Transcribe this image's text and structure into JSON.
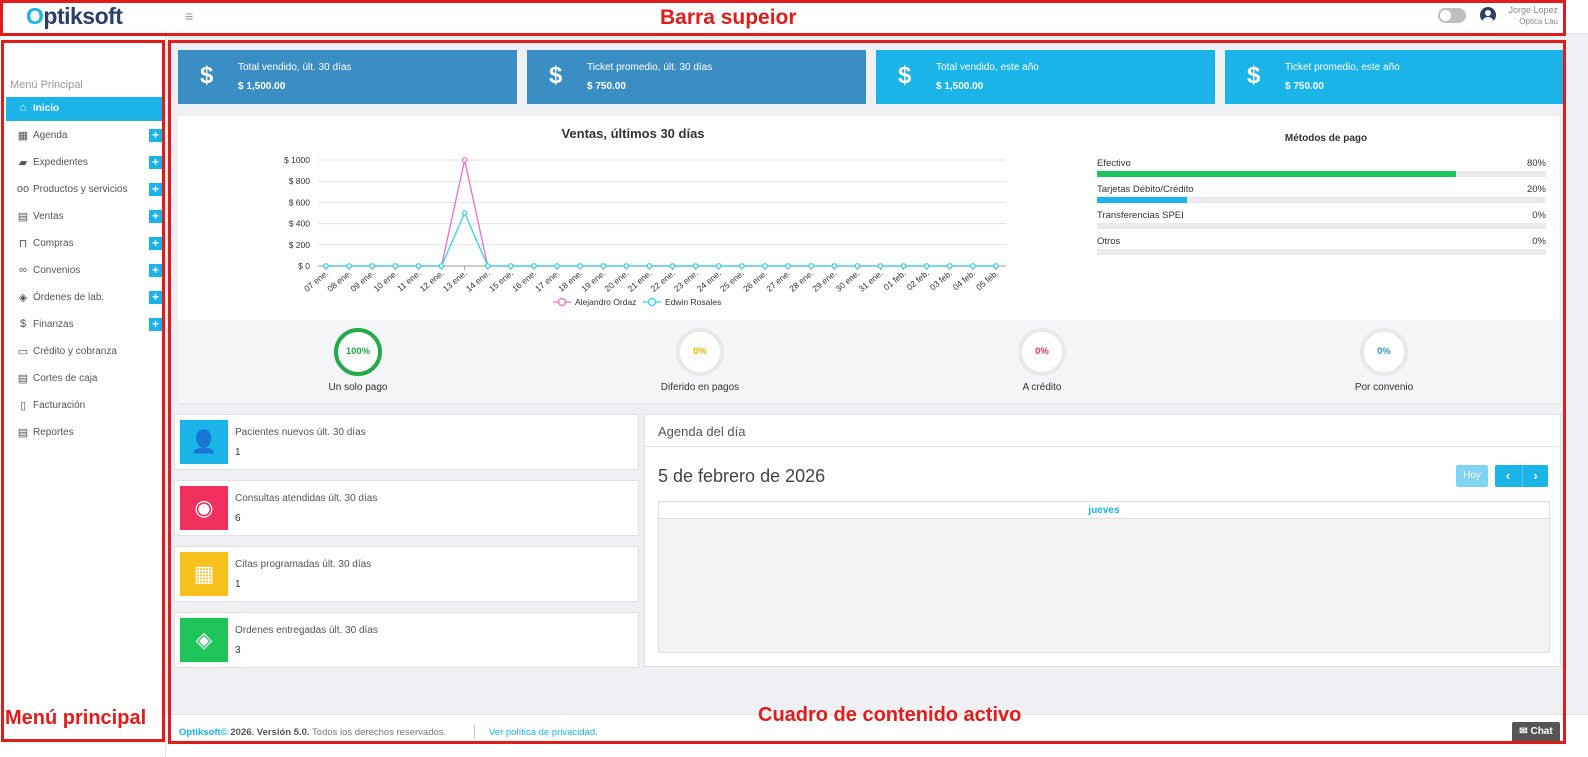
{
  "annotations": {
    "top": "Barra supeior",
    "menu": "Menú principal",
    "content": "Cuadro de contenido activo"
  },
  "topbar": {
    "logo_o": "O",
    "logo_rest": "ptiksoft",
    "hamburger_icon": "menu-icon",
    "user_name": "Jorge Lopez",
    "user_org": "Optica Lau"
  },
  "sidebar": {
    "title": "Menú Principal",
    "items": [
      {
        "label": "Inicio",
        "icon": "home-icon",
        "glyph": "⌂",
        "plus": false,
        "active": true
      },
      {
        "label": "Agenda",
        "icon": "calendar-icon",
        "glyph": "▦",
        "plus": true
      },
      {
        "label": "Expedientes",
        "icon": "folder-icon",
        "glyph": "▰",
        "plus": true
      },
      {
        "label": "Productos y servicios",
        "icon": "glasses-icon",
        "glyph": "oo",
        "plus": true
      },
      {
        "label": "Ventas",
        "icon": "cash-register-icon",
        "glyph": "▤",
        "plus": true
      },
      {
        "label": "Compras",
        "icon": "basket-icon",
        "glyph": "⊓",
        "plus": true
      },
      {
        "label": "Convenios",
        "icon": "handshake-icon",
        "glyph": "∞",
        "plus": true
      },
      {
        "label": "Órdenes de lab.",
        "icon": "tags-icon",
        "glyph": "◈",
        "plus": true
      },
      {
        "label": "Finanzas",
        "icon": "hand-money-icon",
        "glyph": "$",
        "plus": true
      },
      {
        "label": "Crédito y cobranza",
        "icon": "money-bill-icon",
        "glyph": "▭",
        "plus": false
      },
      {
        "label": "Cortes de caja",
        "icon": "register-icon",
        "glyph": "▤",
        "plus": false
      },
      {
        "label": "Facturación",
        "icon": "invoice-icon",
        "glyph": "▯",
        "plus": false
      },
      {
        "label": "Reportes",
        "icon": "file-icon",
        "glyph": "▤",
        "plus": false
      }
    ]
  },
  "stats": [
    {
      "label": "Total vendido, últ. 30 días",
      "value": "$ 1,500.00",
      "color": "#3a8ec4",
      "icon": "dollar-icon"
    },
    {
      "label": "Ticket promedio, últ. 30 días",
      "value": "$ 750.00",
      "color": "#3a8ec4",
      "icon": "dollar-icon"
    },
    {
      "label": "Total vendido, este año",
      "value": "$ 1,500.00",
      "color": "#1ab4e8",
      "icon": "dollar-icon"
    },
    {
      "label": "Ticket promedio, este año",
      "value": "$ 750.00",
      "color": "#1ab4e8",
      "icon": "dollar-icon"
    }
  ],
  "chart_data": {
    "type": "line",
    "title": "Ventas, últimos 30 días",
    "xlabel": "",
    "ylabel": "",
    "ylim": [
      0,
      1000
    ],
    "yticks": [
      "$ 0",
      "$ 200",
      "$ 400",
      "$ 600",
      "$ 800",
      "$ 1000"
    ],
    "categories": [
      "07 ene.",
      "08 ene.",
      "09 ene.",
      "10 ene.",
      "11 ene.",
      "12 ene.",
      "13 ene.",
      "14 ene.",
      "15 ene.",
      "16 ene.",
      "17 ene.",
      "18 ene.",
      "19 ene.",
      "20 ene.",
      "21 ene.",
      "22 ene.",
      "23 ene.",
      "24 ene.",
      "25 ene.",
      "26 ene.",
      "27 ene.",
      "28 ene.",
      "29 ene.",
      "30 ene.",
      "31 ene.",
      "01 feb.",
      "02 feb.",
      "03 feb.",
      "04 feb.",
      "05 feb."
    ],
    "series": [
      {
        "name": "Alejandro Ordaz",
        "color": "#f06bd0",
        "values": [
          0,
          0,
          0,
          0,
          0,
          0,
          1000,
          0,
          0,
          0,
          0,
          0,
          0,
          0,
          0,
          0,
          0,
          0,
          0,
          0,
          0,
          0,
          0,
          0,
          0,
          0,
          0,
          0,
          0,
          0
        ]
      },
      {
        "name": "Edwin Rosales",
        "color": "#2fd3e8",
        "values": [
          0,
          0,
          0,
          0,
          0,
          0,
          500,
          0,
          0,
          0,
          0,
          0,
          0,
          0,
          0,
          0,
          0,
          0,
          0,
          0,
          0,
          0,
          0,
          0,
          0,
          0,
          0,
          0,
          0,
          0
        ]
      }
    ],
    "grid": true,
    "legend": "bottom"
  },
  "payments": {
    "title": "Métodos de pago",
    "rows": [
      {
        "label": "Efectivo",
        "pct": "80%",
        "value": 80,
        "color": "#1ec55a"
      },
      {
        "label": "Tarjetas Débito/Crédito",
        "pct": "20%",
        "value": 20,
        "color": "#1ab4e8"
      },
      {
        "label": "Transferencias SPEI",
        "pct": "0%",
        "value": 0,
        "color": "#1ab4e8"
      },
      {
        "label": "Otros",
        "pct": "0%",
        "value": 0,
        "color": "#1ab4e8"
      }
    ]
  },
  "circles": [
    {
      "value": "100%",
      "fraction": 1.0,
      "label": "Un solo pago",
      "color": "#23a84a"
    },
    {
      "value": "0%",
      "fraction": 0,
      "label": "Diferido en pagos",
      "color": "#f0b400"
    },
    {
      "value": "0%",
      "fraction": 0,
      "label": "A crédito",
      "color": "#e23357"
    },
    {
      "value": "0%",
      "fraction": 0,
      "label": "Por convenio",
      "color": "#3a8ec4"
    }
  ],
  "kpis": [
    {
      "label": "Pacientes nuevos últ. 30 días",
      "value": "1",
      "color": "#1ab4e8",
      "icon": "user-check-icon",
      "glyph": "👤"
    },
    {
      "label": "Consultas atendidas últ. 30 días",
      "value": "6",
      "color": "#f2305e",
      "icon": "eye-icon",
      "glyph": "◉"
    },
    {
      "label": "Citas programadas últ. 30 días",
      "value": "1",
      "color": "#f7c01b",
      "icon": "calendar-icon",
      "glyph": "▦"
    },
    {
      "label": "Ordenes entregadas últ. 30 días",
      "value": "3",
      "color": "#1ec55a",
      "icon": "tags-icon",
      "glyph": "◈"
    }
  ],
  "agenda": {
    "title": "Agenda del día",
    "date": "5 de febrero de 2026",
    "today_button": "Hoy",
    "prev": "‹",
    "next": "›",
    "day": "jueves"
  },
  "footer": {
    "brand": "Optiksoft©",
    "version": " 2026. Versión 5.0.",
    "rights": " Todos los derechos reservados.",
    "link": "Ver política de privacidad.",
    "chat": "Chat"
  }
}
